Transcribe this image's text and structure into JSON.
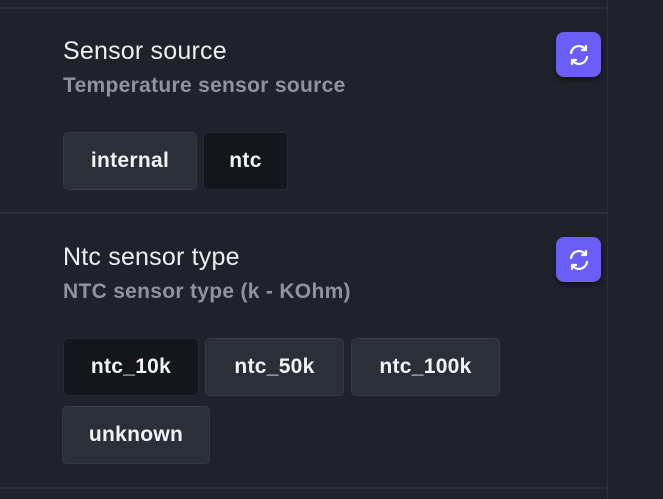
{
  "sections": [
    {
      "title": "Sensor source",
      "description": "Temperature sensor source",
      "refresh_icon": "refresh-icon",
      "options": [
        {
          "label": "internal",
          "selected": false
        },
        {
          "label": "ntc",
          "selected": true
        }
      ]
    },
    {
      "title": "Ntc sensor type",
      "description": "NTC sensor type (k - KOhm)",
      "refresh_icon": "refresh-icon",
      "options": [
        {
          "label": "ntc_10k",
          "selected": true
        },
        {
          "label": "ntc_50k",
          "selected": false
        },
        {
          "label": "ntc_100k",
          "selected": false
        },
        {
          "label": "unknown",
          "selected": false
        }
      ]
    }
  ],
  "colors": {
    "background": "#1f222a",
    "accent": "#6b5ef6",
    "option_bg": "#2b2f37",
    "option_selected_bg": "#14161b",
    "title": "#eceef2",
    "description": "#8f939d"
  }
}
